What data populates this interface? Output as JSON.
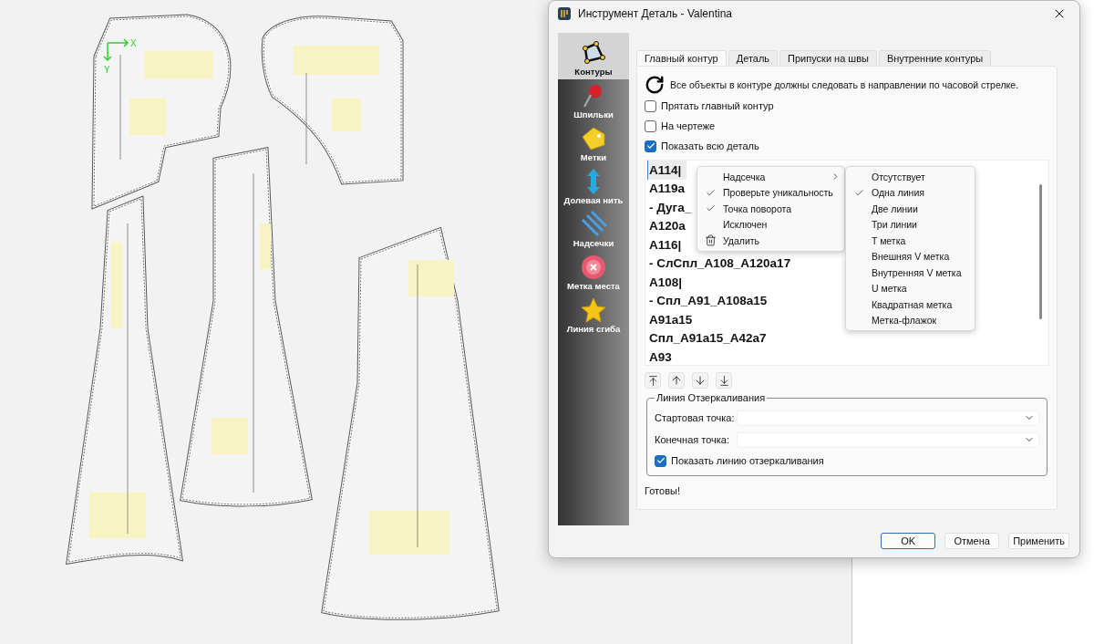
{
  "canvas": {
    "axis_labels": [
      "X",
      "Y"
    ]
  },
  "window": {
    "title": "Инструмент Деталь - Valentina"
  },
  "sidebar": {
    "items": [
      {
        "label": "Контуры",
        "kind": "polygon",
        "selected": true
      },
      {
        "label": "Шпильки",
        "kind": "pin",
        "selected": false
      },
      {
        "label": "Метки",
        "kind": "tag",
        "selected": false
      },
      {
        "label": "Долевая нить",
        "kind": "arrow",
        "selected": false
      },
      {
        "label": "Надсечки",
        "kind": "lines",
        "selected": false
      },
      {
        "label": "Метка места",
        "kind": "button",
        "selected": false
      },
      {
        "label": "Линия сгиба",
        "kind": "star",
        "selected": false
      }
    ]
  },
  "tabs": [
    {
      "label": "Главный контур",
      "selected": true
    },
    {
      "label": "Деталь",
      "selected": false
    },
    {
      "label": "Припуски на швы",
      "selected": false
    },
    {
      "label": "Внутренние контуры",
      "selected": false
    }
  ],
  "main": {
    "notice": "Все объекты в контуре должны следовать в направлении по часовой стрелке.",
    "checkboxes": [
      {
        "label": "Прятать главный контур",
        "checked": false
      },
      {
        "label": "На чертеже",
        "checked": false
      },
      {
        "label": "Показать всю деталь",
        "checked": true
      }
    ],
    "points": [
      {
        "text": "A114|",
        "selected": true
      },
      {
        "text": "A119a",
        "selected": false
      },
      {
        "text": "- Дуга_",
        "selected": false
      },
      {
        "text": "A120a",
        "selected": false
      },
      {
        "text": "A116|",
        "selected": false
      },
      {
        "text": "- СлСпл_A108_A120a17",
        "selected": false
      },
      {
        "text": "A108|",
        "selected": false
      },
      {
        "text": "- Спл_A91_A108a15",
        "selected": false
      },
      {
        "text": "A91a15",
        "selected": false
      },
      {
        "text": "Спл_A91a15_A42a7",
        "selected": false
      },
      {
        "text": "A93",
        "selected": false
      }
    ],
    "context_menu": {
      "items": [
        {
          "label": "Надсечка",
          "kind": "submenu",
          "checked": false
        },
        {
          "label": "Проверьте уникальность",
          "kind": "check",
          "checked": true
        },
        {
          "label": "Точка поворота",
          "kind": "check",
          "checked": true
        },
        {
          "label": "Исключен",
          "kind": "check",
          "checked": false
        },
        {
          "label": "Удалить",
          "kind": "delete"
        }
      ]
    },
    "submenu": {
      "items": [
        {
          "label": "Отсутствует",
          "checked": false
        },
        {
          "label": "Одна линия",
          "checked": true
        },
        {
          "label": "Две линии",
          "checked": false
        },
        {
          "label": "Три линии",
          "checked": false
        },
        {
          "label": "T метка",
          "checked": false
        },
        {
          "label": "Внешняя V метка",
          "checked": false
        },
        {
          "label": "Внутренняя V метка",
          "checked": false
        },
        {
          "label": "U метка",
          "checked": false
        },
        {
          "label": "Квадратная метка",
          "checked": false
        },
        {
          "label": "Метка-флажок",
          "checked": false
        }
      ]
    },
    "mirror_group": {
      "title": "Линия Отзеркаливания",
      "fields": [
        {
          "label": "Стартовая точка:"
        },
        {
          "label": "Конечная точка:"
        }
      ],
      "show_line": {
        "label": "Показать линию отзеркаливания",
        "checked": true
      }
    },
    "status": "Готовы!"
  },
  "buttons": [
    {
      "label": "OK",
      "default": true
    },
    {
      "label": "Отмена",
      "default": false
    },
    {
      "label": "Применить",
      "default": false
    }
  ]
}
